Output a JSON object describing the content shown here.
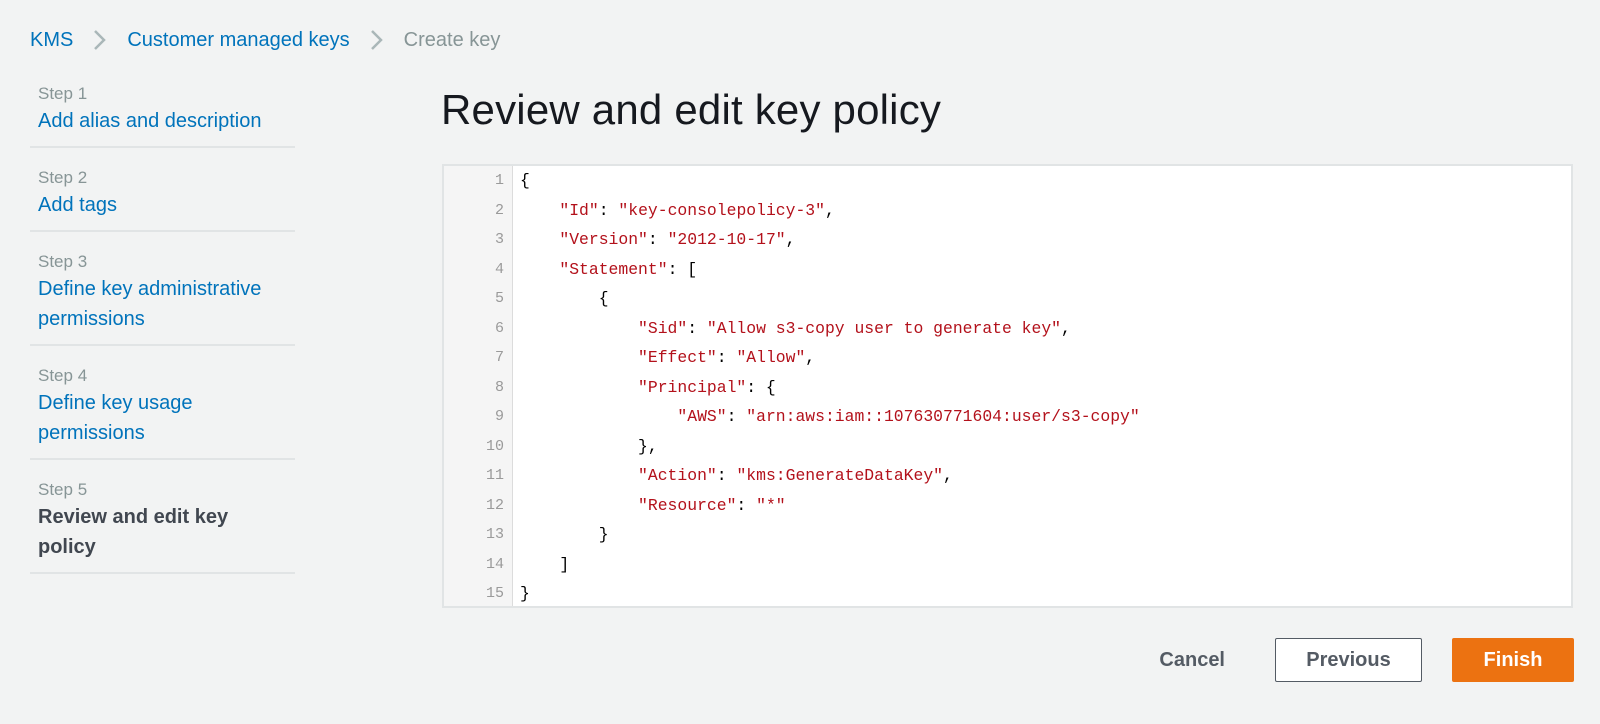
{
  "breadcrumb": {
    "items": [
      {
        "label": "KMS"
      },
      {
        "label": "Customer managed keys"
      }
    ],
    "current": "Create key"
  },
  "steps": [
    {
      "step": "Step 1",
      "title": "Add alias and description",
      "active": false
    },
    {
      "step": "Step 2",
      "title": "Add tags",
      "active": false
    },
    {
      "step": "Step 3",
      "title": "Define key administrative permissions",
      "active": false
    },
    {
      "step": "Step 4",
      "title": "Define key usage permissions",
      "active": false
    },
    {
      "step": "Step 5",
      "title": "Review and edit key policy",
      "active": true
    }
  ],
  "page_title": "Review and edit key policy",
  "editor": {
    "lines": [
      {
        "n": "1",
        "tokens": [
          {
            "t": "{",
            "k": "punc"
          }
        ]
      },
      {
        "n": "2",
        "tokens": [
          {
            "t": "    ",
            "k": "punc"
          },
          {
            "t": "\"Id\"",
            "k": "str"
          },
          {
            "t": ": ",
            "k": "punc"
          },
          {
            "t": "\"key-consolepolicy-3\"",
            "k": "str"
          },
          {
            "t": ",",
            "k": "punc"
          }
        ]
      },
      {
        "n": "3",
        "tokens": [
          {
            "t": "    ",
            "k": "punc"
          },
          {
            "t": "\"Version\"",
            "k": "str"
          },
          {
            "t": ": ",
            "k": "punc"
          },
          {
            "t": "\"2012-10-17\"",
            "k": "str"
          },
          {
            "t": ",",
            "k": "punc"
          }
        ]
      },
      {
        "n": "4",
        "tokens": [
          {
            "t": "    ",
            "k": "punc"
          },
          {
            "t": "\"Statement\"",
            "k": "str"
          },
          {
            "t": ": [",
            "k": "punc"
          }
        ]
      },
      {
        "n": "5",
        "tokens": [
          {
            "t": "        {",
            "k": "punc"
          }
        ]
      },
      {
        "n": "6",
        "tokens": [
          {
            "t": "            ",
            "k": "punc"
          },
          {
            "t": "\"Sid\"",
            "k": "str"
          },
          {
            "t": ": ",
            "k": "punc"
          },
          {
            "t": "\"Allow s3-copy user to generate key\"",
            "k": "str"
          },
          {
            "t": ",",
            "k": "punc"
          }
        ]
      },
      {
        "n": "7",
        "tokens": [
          {
            "t": "            ",
            "k": "punc"
          },
          {
            "t": "\"Effect\"",
            "k": "str"
          },
          {
            "t": ": ",
            "k": "punc"
          },
          {
            "t": "\"Allow\"",
            "k": "str"
          },
          {
            "t": ",",
            "k": "punc"
          }
        ]
      },
      {
        "n": "8",
        "tokens": [
          {
            "t": "            ",
            "k": "punc"
          },
          {
            "t": "\"Principal\"",
            "k": "str"
          },
          {
            "t": ": {",
            "k": "punc"
          }
        ]
      },
      {
        "n": "9",
        "tokens": [
          {
            "t": "                ",
            "k": "punc"
          },
          {
            "t": "\"AWS\"",
            "k": "str"
          },
          {
            "t": ": ",
            "k": "punc"
          },
          {
            "t": "\"arn:aws:iam::107630771604:user/s3-copy\"",
            "k": "str"
          }
        ]
      },
      {
        "n": "10",
        "tokens": [
          {
            "t": "            },",
            "k": "punc"
          }
        ]
      },
      {
        "n": "11",
        "tokens": [
          {
            "t": "            ",
            "k": "punc"
          },
          {
            "t": "\"Action\"",
            "k": "str"
          },
          {
            "t": ": ",
            "k": "punc"
          },
          {
            "t": "\"kms:GenerateDataKey\"",
            "k": "str"
          },
          {
            "t": ",",
            "k": "punc"
          }
        ]
      },
      {
        "n": "12",
        "tokens": [
          {
            "t": "            ",
            "k": "punc"
          },
          {
            "t": "\"Resource\"",
            "k": "str"
          },
          {
            "t": ": ",
            "k": "punc"
          },
          {
            "t": "\"*\"",
            "k": "str"
          }
        ]
      },
      {
        "n": "13",
        "tokens": [
          {
            "t": "        }",
            "k": "punc"
          }
        ]
      },
      {
        "n": "14",
        "tokens": [
          {
            "t": "    ]",
            "k": "punc"
          }
        ]
      },
      {
        "n": "15",
        "tokens": [
          {
            "t": "}",
            "k": "punc"
          }
        ]
      }
    ]
  },
  "actions": {
    "cancel": "Cancel",
    "previous": "Previous",
    "finish": "Finish"
  },
  "colors": {
    "link": "#0073bb",
    "accent": "#ec7211",
    "string": "#b3111b",
    "background": "#f2f3f3"
  }
}
